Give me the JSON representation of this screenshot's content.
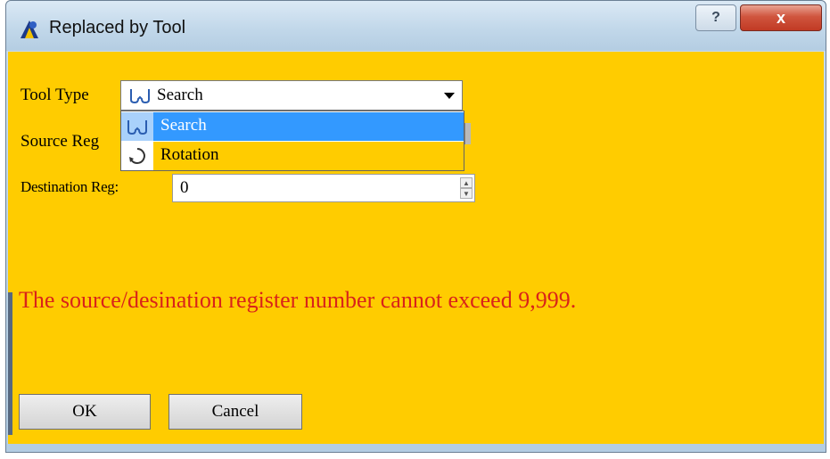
{
  "window": {
    "title": "Replaced by Tool",
    "help_label": "?",
    "close_label": "x"
  },
  "form": {
    "tool_type_label": "Tool Type",
    "tool_type_value": "Search",
    "source_reg_label": "Source Reg",
    "destination_reg_label": "Destination Reg:",
    "destination_reg_value": "0"
  },
  "dropdown": {
    "items": [
      {
        "label": "Search",
        "icon": "search-tool-icon",
        "selected": true
      },
      {
        "label": "Rotation",
        "icon": "rotation-tool-icon",
        "selected": false
      }
    ]
  },
  "message": "The source/desination register number cannot exceed 9,999.",
  "buttons": {
    "ok": "OK",
    "cancel": "Cancel"
  },
  "colors": {
    "background": "#ffcc00",
    "message": "#d9231a",
    "selection": "#3399ff",
    "close": "#c13a24"
  }
}
